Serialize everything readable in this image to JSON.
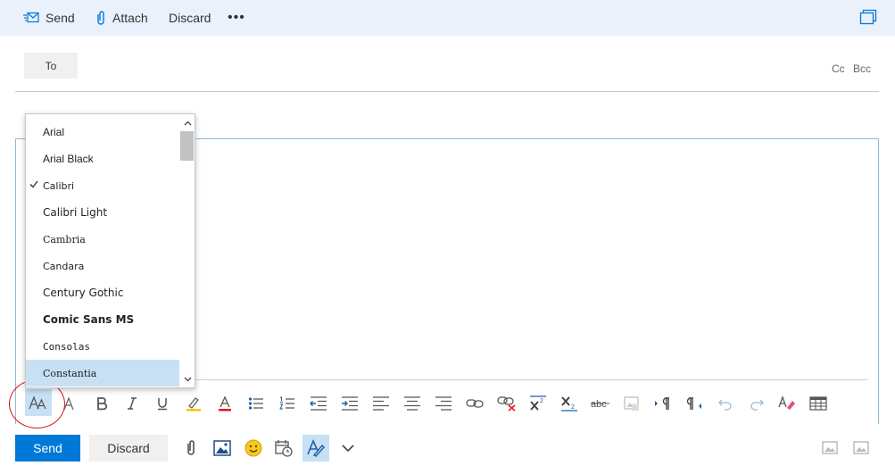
{
  "commandbar": {
    "send": "Send",
    "attach": "Attach",
    "discard": "Discard",
    "more": "•••"
  },
  "recipients": {
    "to": "To",
    "cc": "Cc",
    "bcc": "Bcc"
  },
  "font_menu": {
    "items": [
      "Arial",
      "Arial Black",
      "Calibri",
      "Calibri Light",
      "Cambria",
      "Candara",
      "Century Gothic",
      "Comic Sans MS",
      "Consolas",
      "Constantia"
    ],
    "selected": "Calibri",
    "highlighted": "Constantia"
  },
  "footer": {
    "send": "Send",
    "discard": "Discard"
  },
  "colors": {
    "accent": "#0078d7",
    "commandbar_bg": "#eaf1fb",
    "highlight": "#c7e0f4",
    "annotation": "#dd1111"
  }
}
